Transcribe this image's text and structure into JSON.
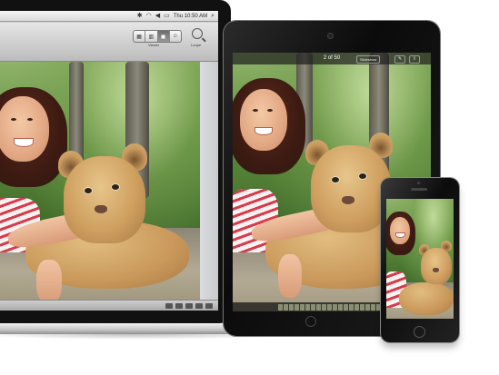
{
  "macbook": {
    "menubar": {
      "time": "Thu 10:50 AM",
      "icons": [
        "bluetooth-icon",
        "wifi-icon",
        "volume-icon",
        "battery-icon",
        "spotlight-icon"
      ]
    },
    "toolbar": {
      "view_modes": [
        "grid-icon",
        "split-icon",
        "faces-icon",
        "places-icon"
      ],
      "active_view": "Viewer",
      "viewer_label": "Viewer",
      "loupe_label": "Loupe"
    },
    "bottombar_icons": [
      "rotate-icon",
      "edit-icon",
      "adjust-icon",
      "info-icon",
      "share-icon"
    ]
  },
  "ipad": {
    "counter": "2 of 50",
    "slideshow_label": "Slideshow"
  },
  "colors": {
    "device_black": "#111111",
    "aluminum": "#c4c4c4",
    "foliage_green": "#5d8a3c"
  }
}
